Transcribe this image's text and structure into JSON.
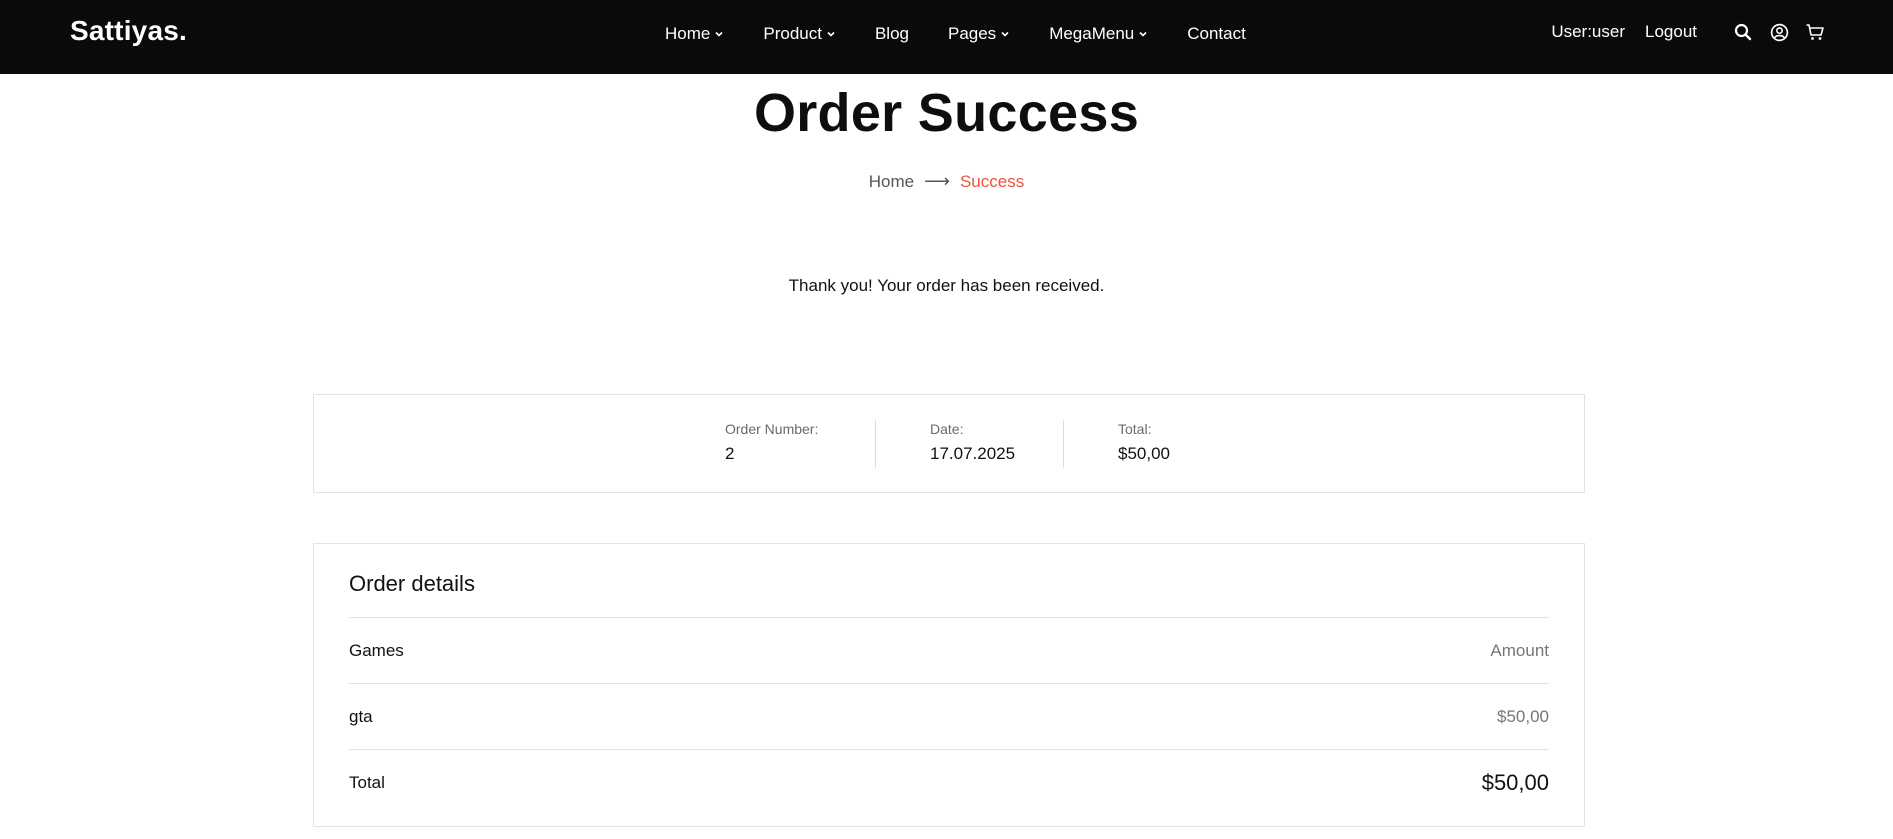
{
  "header": {
    "logo": "Sattiyas.",
    "nav": [
      {
        "label": "Home",
        "has_dropdown": true
      },
      {
        "label": "Product",
        "has_dropdown": true
      },
      {
        "label": "Blog",
        "has_dropdown": false
      },
      {
        "label": "Pages",
        "has_dropdown": true
      },
      {
        "label": "MegaMenu",
        "has_dropdown": true
      },
      {
        "label": "Contact",
        "has_dropdown": false
      }
    ],
    "user_label": "User:user",
    "logout_label": "Logout",
    "icons": [
      "search-icon",
      "account-icon",
      "cart-icon"
    ]
  },
  "page": {
    "title": "Order Success",
    "breadcrumb": {
      "home": "Home",
      "separator": "⟶",
      "current": "Success"
    },
    "thanks_message": "Thank you! Your order has been received."
  },
  "summary": {
    "order_number_label": "Order Number:",
    "order_number": "2",
    "date_label": "Date:",
    "date": "17.07.2025",
    "total_label": "Total:",
    "total": "$50,00"
  },
  "order_details": {
    "title": "Order details",
    "header_left": "Games",
    "header_right": "Amount",
    "items": [
      {
        "name": "gta",
        "amount": "$50,00"
      }
    ],
    "total_label": "Total",
    "total_value": "$50,00"
  },
  "colors": {
    "header_bg": "#0a0a0a",
    "accent": "#e8553f",
    "border": "#e2e2e2"
  }
}
